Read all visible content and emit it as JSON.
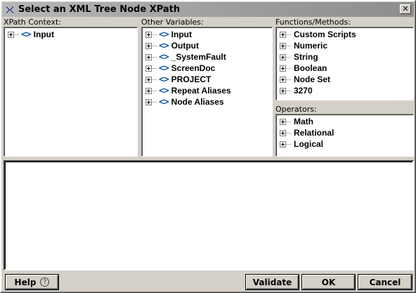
{
  "window": {
    "title": "Select an XML Tree Node XPath",
    "close_glyph": "✕"
  },
  "xpath_context": {
    "label": "XPath Context:",
    "items": [
      {
        "label": "Input",
        "icon": "xml-node-icon",
        "icon_glyph": "<>"
      }
    ]
  },
  "other_variables": {
    "label": "Other Variables:",
    "items": [
      {
        "label": "Input",
        "icon": "xml-node-icon",
        "icon_glyph": "<>"
      },
      {
        "label": "Output",
        "icon": "xml-node-icon",
        "icon_glyph": "<>"
      },
      {
        "label": "_SystemFault",
        "icon": "xml-node-icon",
        "icon_glyph": "<>"
      },
      {
        "label": "ScreenDoc",
        "icon": "xml-node-icon",
        "icon_glyph": "<>"
      },
      {
        "label": "PROJECT",
        "icon": "xml-node-icon",
        "icon_glyph": "<>"
      },
      {
        "label": "Repeat Aliases",
        "icon": "xml-node-icon",
        "icon_glyph": "<>"
      },
      {
        "label": "Node Aliases",
        "icon": "xml-node-icon",
        "icon_glyph": "<>"
      }
    ]
  },
  "functions": {
    "label": "Functions/Methods:",
    "items": [
      {
        "label": "Custom Scripts"
      },
      {
        "label": "Numeric"
      },
      {
        "label": "String"
      },
      {
        "label": "Boolean"
      },
      {
        "label": "Node Set"
      },
      {
        "label": "3270"
      }
    ]
  },
  "operators": {
    "label": "Operators:",
    "items": [
      {
        "label": "Math"
      },
      {
        "label": "Relational"
      },
      {
        "label": "Logical"
      }
    ]
  },
  "editor": {
    "value": ""
  },
  "buttons": {
    "help": "Help",
    "help_glyph": "?",
    "validate": "Validate",
    "ok": "OK",
    "cancel": "Cancel"
  },
  "colors": {
    "node_icon": "#1a5aa8",
    "dialog_bg": "#d4d0c8",
    "titlebar": "#9c9c9c"
  }
}
